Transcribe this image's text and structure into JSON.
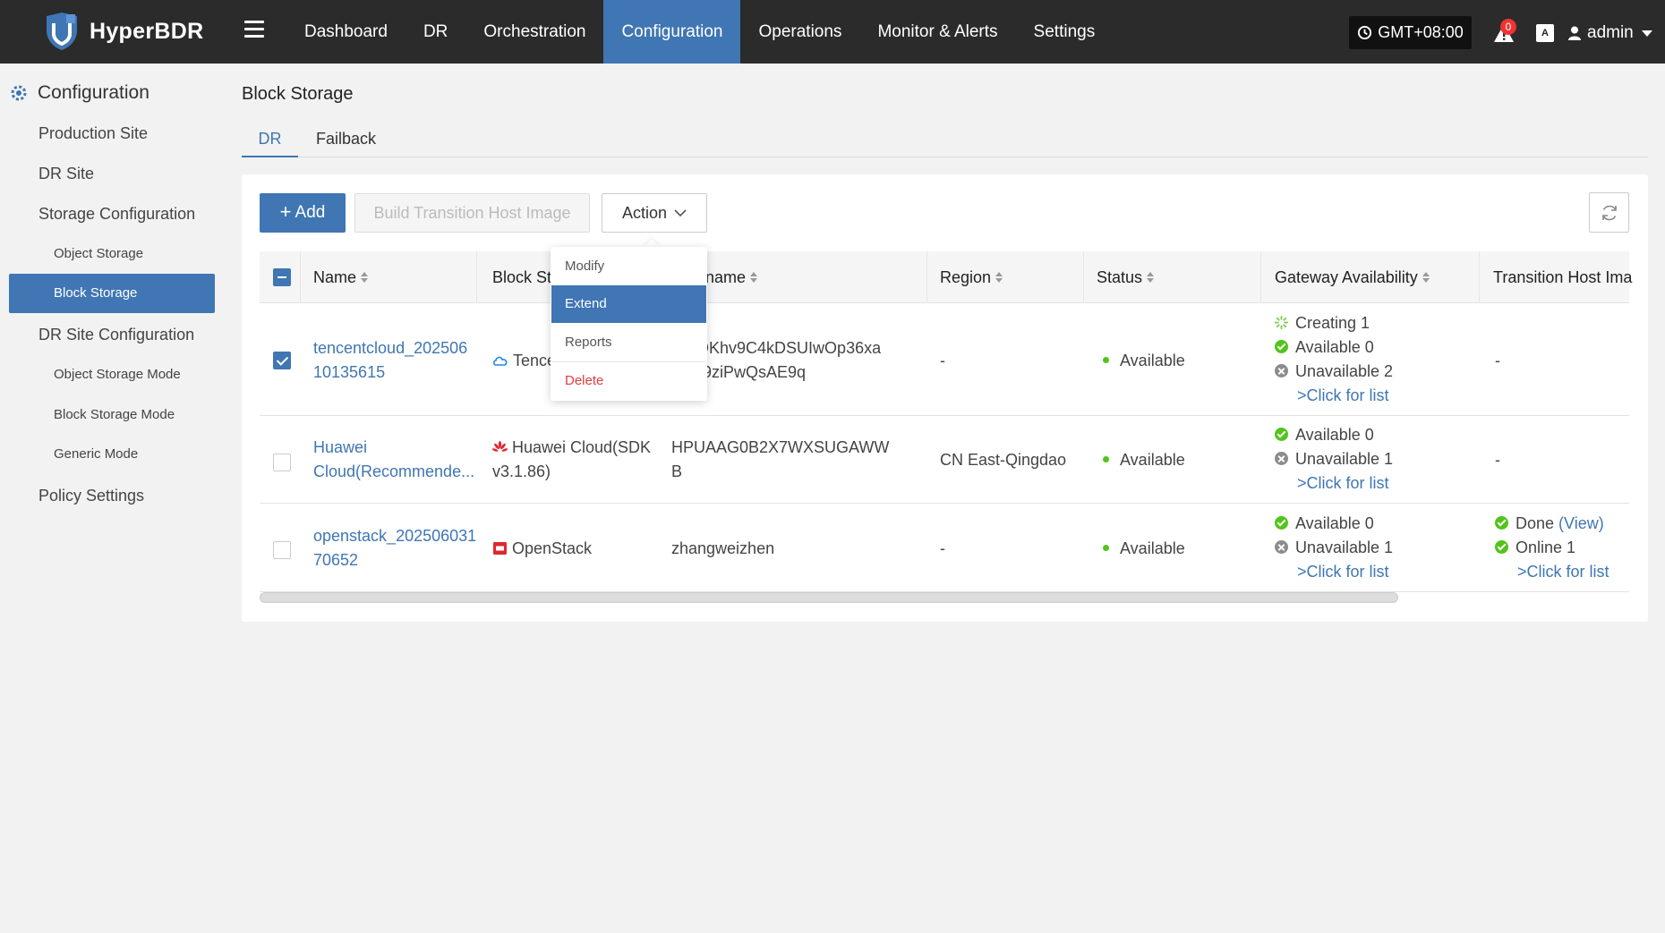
{
  "app": {
    "name": "HyperBDR"
  },
  "nav": {
    "items": [
      "Dashboard",
      "DR",
      "Orchestration",
      "Configuration",
      "Operations",
      "Monitor & Alerts",
      "Settings"
    ],
    "active": "Configuration"
  },
  "header": {
    "timezone": "GMT+08:00",
    "alert_count": "0",
    "lang_label": "A",
    "user": "admin"
  },
  "sidebar": {
    "title": "Configuration",
    "items": [
      {
        "label": "Production Site",
        "level": 1
      },
      {
        "label": "DR Site",
        "level": 1
      },
      {
        "label": "Storage Configuration",
        "level": 1
      },
      {
        "label": "Object Storage",
        "level": 2
      },
      {
        "label": "Block Storage",
        "level": 2,
        "active": true
      },
      {
        "label": "DR Site Configuration",
        "level": 1
      },
      {
        "label": "Object Storage Mode",
        "level": 2
      },
      {
        "label": "Block Storage Mode",
        "level": 2
      },
      {
        "label": "Generic Mode",
        "level": 2
      },
      {
        "label": "Policy Settings",
        "level": 1
      }
    ]
  },
  "main": {
    "title": "Block Storage",
    "tabs": [
      "DR",
      "Failback"
    ],
    "active_tab": "DR"
  },
  "toolbar": {
    "add_label": "Add",
    "build_label": "Build Transition Host Image",
    "action_label": "Action"
  },
  "action_menu": {
    "items": [
      "Modify",
      "Extend",
      "Reports",
      "Delete"
    ],
    "active": "Extend"
  },
  "table": {
    "columns": [
      "Name",
      "Block Sto",
      "Username",
      "Region",
      "Status",
      "Gateway Availability",
      "Transition Host Ima"
    ],
    "rows": [
      {
        "selected": true,
        "name": [
          "tencentcloud_202506",
          "10135615"
        ],
        "block_storage": [
          "Tence"
        ],
        "username": [
          "AKIDKhv9C4kDSUIwOp36xa",
          "0EH9ziPwQsAE9q"
        ],
        "region": "-",
        "status": "Available",
        "gateway": {
          "creating": "Creating 1",
          "available": "Available 0",
          "unavailable": "Unavailable 2",
          "link": ">Click for list"
        },
        "transition": {
          "text": "-"
        }
      },
      {
        "selected": false,
        "name": [
          "Huawei",
          "Cloud(Recommende..."
        ],
        "block_storage": [
          "Huawei Cloud(SDK",
          "v3.1.86)"
        ],
        "username": [
          "HPUAAG0B2X7WXSUGAWW",
          "B"
        ],
        "region": "CN East-Qingdao",
        "status": "Available",
        "gateway": {
          "available": "Available 0",
          "unavailable": "Unavailable 1",
          "link": ">Click for list"
        },
        "transition": {
          "text": "-"
        }
      },
      {
        "selected": false,
        "name": [
          "openstack_202506031",
          "70652"
        ],
        "block_storage": [
          "OpenStack"
        ],
        "username": [
          "zhangweizhen"
        ],
        "region": "-",
        "status": "Available",
        "gateway": {
          "available": "Available 0",
          "unavailable": "Unavailable 1",
          "link": ">Click for list"
        },
        "transition": {
          "done": "Done",
          "view": "(View)",
          "online": "Online 1",
          "link": ">Click for list"
        }
      }
    ]
  },
  "colors": {
    "accent": "#3f76b3",
    "topbar": "#2b2b2b",
    "success": "#52c41a",
    "danger": "#e03c3c"
  },
  "icons": [
    "shield-logo-icon",
    "hamburger-icon",
    "clock-icon",
    "alert-icon",
    "translate-icon",
    "user-icon",
    "gear-icon",
    "refresh-icon",
    "sort-icon",
    "cloud-icon",
    "huawei-icon",
    "openstack-icon"
  ]
}
